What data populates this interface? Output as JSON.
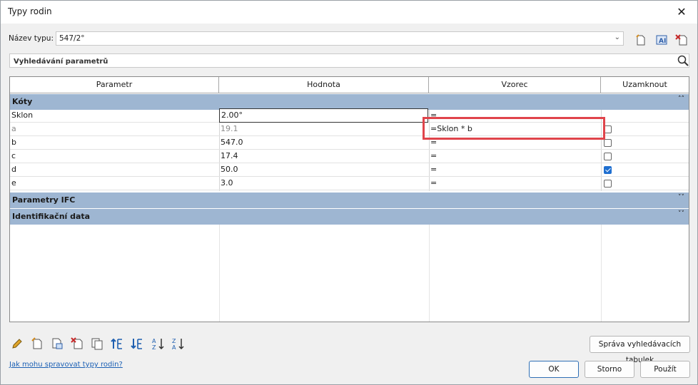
{
  "window": {
    "title": "Typy rodin",
    "close_glyph": "✕"
  },
  "type_row": {
    "label": "Název typu:",
    "value": "547/2°"
  },
  "toolbar_icons": [
    "new-type-icon",
    "rename-type-icon",
    "delete-type-icon"
  ],
  "search": {
    "placeholder": "Vyhledávání parametrů"
  },
  "columns": [
    "Parametr",
    "Hodnota",
    "Vzorec",
    "Uzamknout"
  ],
  "groups": {
    "koty": {
      "label": "Kóty",
      "icon": "collapse-up-icon",
      "glyph": "˄˄"
    },
    "ifc": {
      "label": "Parametry IFC",
      "icon": "expand-down-icon",
      "glyph": "˅˅"
    },
    "ident": {
      "label": "Identifikační data",
      "icon": "expand-down-icon",
      "glyph": "˅˅"
    }
  },
  "rows": [
    {
      "param": "Sklon",
      "value": "2.00°",
      "formula": "=",
      "locked": null
    },
    {
      "param": "a",
      "value": "19.1",
      "formula": "=Sklon * b",
      "locked": false,
      "greyed": true
    },
    {
      "param": "b",
      "value": "547.0",
      "formula": "=",
      "locked": false
    },
    {
      "param": "c",
      "value": "17.4",
      "formula": "=",
      "locked": false
    },
    {
      "param": "d",
      "value": "50.0",
      "formula": "=",
      "locked": true
    },
    {
      "param": "e",
      "value": "3.0",
      "formula": "=",
      "locked": false
    }
  ],
  "bottom_icons": [
    "edit-parameter-icon",
    "new-parameter-icon",
    "shared-parameter-icon",
    "delete-parameter-icon",
    "copy-parameter-icon",
    "move-up-icon",
    "move-down-icon",
    "sort-ascending-icon",
    "sort-descending-icon"
  ],
  "buttons": {
    "lookup": "Správa vyhledávacích tabulek",
    "ok": "OK",
    "cancel": "Storno",
    "apply": "Použít"
  },
  "help_link": "Jak mohu spravovat typy rodin?",
  "colors": {
    "group_header": "#9eb6d2",
    "highlight": "#e0444b",
    "link": "#1a5fb4",
    "check": "#1f6fd0"
  }
}
